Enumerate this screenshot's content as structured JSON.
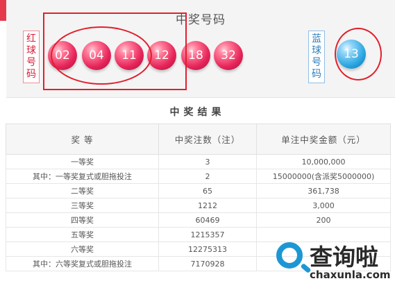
{
  "draw": {
    "title": "中奖号码",
    "red_label": [
      "红",
      "球",
      "号",
      "码"
    ],
    "blue_label": [
      "蓝",
      "球",
      "号",
      "码"
    ],
    "red_balls": [
      "02",
      "04",
      "11",
      "12",
      "18",
      "32"
    ],
    "blue_ball": "13"
  },
  "results": {
    "title": "中奖结果",
    "headers": [
      "奖 等",
      "中奖注数（注）",
      "单注中奖金额（元）"
    ],
    "rows": [
      [
        "一等奖",
        "3",
        "10,000,000"
      ],
      [
        "其中：一等奖复式或胆拖投注",
        "2",
        "15000000(含派奖5000000)"
      ],
      [
        "二等奖",
        "65",
        "361,738"
      ],
      [
        "三等奖",
        "1212",
        "3,000"
      ],
      [
        "四等奖",
        "60469",
        "200"
      ],
      [
        "五等奖",
        "1215357",
        ""
      ],
      [
        "六等奖",
        "12275313",
        ""
      ],
      [
        "其中：六等奖复式或胆拖投注",
        "7170928",
        ""
      ]
    ]
  },
  "watermark": {
    "name": "查询啦",
    "url": "chaxunla.com"
  },
  "colors": {
    "accent_red": "#e43a4c",
    "red_ball": "#e6245a",
    "blue_ball": "#2aa7e3",
    "annotation": "#e31e2b"
  }
}
